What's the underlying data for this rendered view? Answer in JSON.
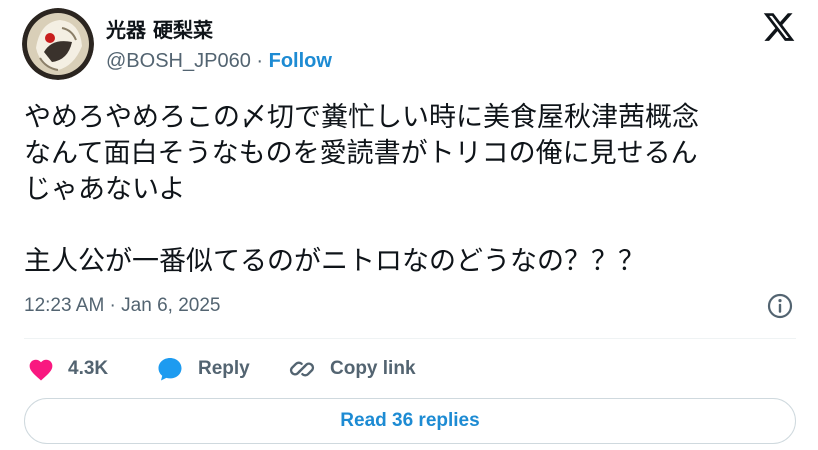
{
  "author": {
    "display_name": "光器 硬梨菜",
    "handle": "@BOSH_JP060",
    "separator": " · ",
    "follow_label": "Follow"
  },
  "platform_logo": "x-logo-icon",
  "tweet": {
    "text": "やめろやめろこの〆切で糞忙しい時に美食屋秋津茜概念\nなんて面白そうなものを愛読書がトリコの俺に見せるん\nじゃあないよ\n\n主人公が一番似てるのがニトロなのどうなの？？？",
    "timestamp": "12:23 AM · Jan 6, 2025"
  },
  "actions": {
    "like_count": "4.3K",
    "reply_label": "Reply",
    "copy_link_label": "Copy link"
  },
  "read_replies_label": "Read 36 replies",
  "colors": {
    "link": "#1d8bd3",
    "like": "#f91880",
    "reply_icon": "#1d9bf0",
    "muted": "#536471"
  }
}
